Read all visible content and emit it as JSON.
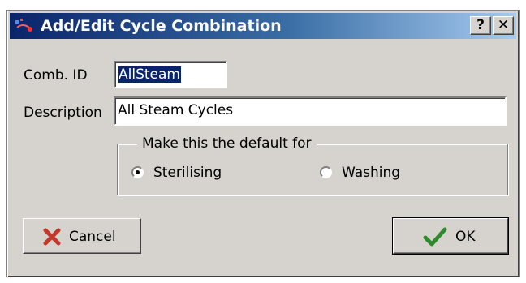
{
  "window": {
    "title": "Add/Edit Cycle Combination",
    "help_label": "?",
    "close_label": "✕"
  },
  "form": {
    "comb_id_label": "Comb. ID",
    "comb_id_value": "AllSteam",
    "description_label": "Description",
    "description_value": "All Steam Cycles"
  },
  "default_group": {
    "title": "Make this the default for",
    "options": [
      {
        "label": "Sterilising",
        "selected": true
      },
      {
        "label": "Washing",
        "selected": false
      }
    ]
  },
  "buttons": {
    "cancel_label": "Cancel",
    "ok_label": "OK"
  },
  "colors": {
    "cancel_icon": "#c0392b",
    "ok_icon": "#2f8a2f",
    "title_bar": "#0a246a"
  }
}
